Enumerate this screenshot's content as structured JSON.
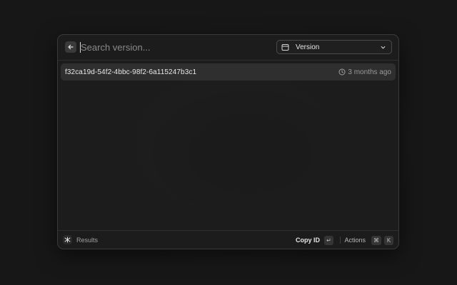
{
  "search": {
    "placeholder": "Search version...",
    "back_icon": "arrow-left-icon"
  },
  "dropdown": {
    "selected": "Version",
    "icon": "window-icon",
    "chevron": "chevron-down-icon"
  },
  "results": [
    {
      "title": "f32ca19d-54f2-4bbc-98f2-6a115247b3c1",
      "accessory_icon": "clock-icon",
      "accessory_text": "3 months ago",
      "selected": true
    }
  ],
  "footer": {
    "title": "Results",
    "logo_icon": "app-logo-icon",
    "primary_action": {
      "label": "Copy ID",
      "shortcut": "↵"
    },
    "actions": {
      "label": "Actions",
      "shortcut": [
        "⌘",
        "K"
      ]
    }
  },
  "colors": {
    "background": "#171717",
    "window": "#1e1e1e",
    "selected_row": "#2f2f2f",
    "text": "#e8e8e8",
    "muted_text": "#9a9a9a"
  }
}
